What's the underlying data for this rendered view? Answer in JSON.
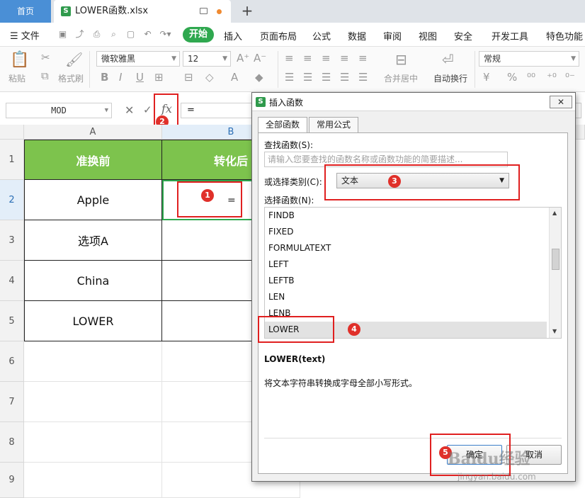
{
  "tabs": {
    "home": "首页",
    "file": "LOWER函数.xlsx"
  },
  "menu": {
    "file": "文件",
    "active": "开始",
    "items": [
      "插入",
      "页面布局",
      "公式",
      "数据",
      "审阅",
      "视图",
      "安全",
      "开发工具",
      "特色功能"
    ]
  },
  "toolbar": {
    "paste": "粘贴",
    "format_painter": "格式刷",
    "font_name": "微软雅黑",
    "font_size": "12",
    "merge": "合并居中",
    "wrap": "自动换行",
    "number_format": "常规"
  },
  "formula_bar": {
    "name_box": "MOD",
    "fx": "fx",
    "content": "="
  },
  "sheet": {
    "columns": [
      "A",
      "B"
    ],
    "rows": [
      "1",
      "2",
      "3",
      "4",
      "5",
      "6",
      "7",
      "8",
      "9"
    ],
    "header_a": "准换前",
    "header_b": "转化后",
    "values_a": [
      "Apple",
      "选项A",
      "China",
      "LOWER"
    ],
    "b2_value": "="
  },
  "dialog": {
    "title": "插入函数",
    "tab_all": "全部函数",
    "tab_common": "常用公式",
    "search_label": "查找函数(S):",
    "search_placeholder": "请输入您要查找的函数名称或函数功能的简要描述...",
    "category_label": "或选择类别(C):",
    "category_value": "文本",
    "select_label": "选择函数(N):",
    "functions": [
      "FINDB",
      "FIXED",
      "FORMULATEXT",
      "LEFT",
      "LEFTB",
      "LEN",
      "LENB",
      "LOWER"
    ],
    "selected_function": "LOWER",
    "signature": "LOWER(text)",
    "description": "将文本字符串转换成字母全部小写形式。",
    "ok": "确定",
    "cancel": "取消",
    "close": "✕"
  },
  "annotations": [
    "1",
    "2",
    "3",
    "4",
    "5"
  ],
  "watermark": {
    "main": "Baidu经验",
    "sub": "jingyan.baidu.com"
  },
  "colors": {
    "accent": "#2fa84f",
    "header_fill": "#7dc34d",
    "annotation": "#e02020"
  }
}
